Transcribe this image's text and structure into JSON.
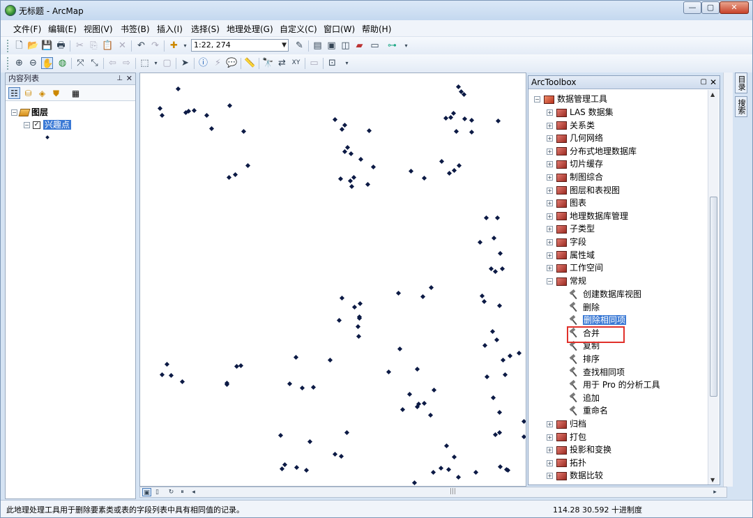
{
  "window": {
    "title": "无标题 - ArcMap",
    "controls": [
      "—",
      "▢",
      "✕"
    ]
  },
  "menus": [
    "文件(F)",
    "编辑(E)",
    "视图(V)",
    "书签(B)",
    "插入(I)",
    "选择(S)",
    "地理处理(G)",
    "自定义(C)",
    "窗口(W)",
    "帮助(H)"
  ],
  "toolbar": {
    "scale": "1:22, 274"
  },
  "toc": {
    "title": "内容列表",
    "root": "图层",
    "layer": "兴趣点"
  },
  "arctoolbox": {
    "title": "ArcToolbox",
    "root": "数据管理工具",
    "toolsets_before": [
      "LAS 数据集",
      "关系类",
      "几何网络",
      "分布式地理数据库",
      "切片缓存",
      "制图综合",
      "图层和表视图",
      "图表",
      "地理数据库管理",
      "子类型",
      "字段",
      "属性域",
      "工作空间"
    ],
    "expanded": "常规",
    "tools": [
      "创建数据库视图",
      "删除",
      "删除相同项",
      "合并",
      "复制",
      "排序",
      "查找相同项",
      "用于 Pro 的分析工具",
      "追加",
      "重命名"
    ],
    "selected_tool": "删除相同项",
    "toolsets_after": [
      "归档",
      "打包",
      "投影和变换",
      "拓扑",
      "数据比较"
    ]
  },
  "side_tabs": [
    "目录",
    "搜索"
  ],
  "status": {
    "message": "此地理处理工具用于删除要素类或表的字段列表中具有相同值的记录。",
    "coords": "114.28  30.592 十进制度"
  },
  "icons": {
    "app": "arcmap-globe-icon"
  }
}
